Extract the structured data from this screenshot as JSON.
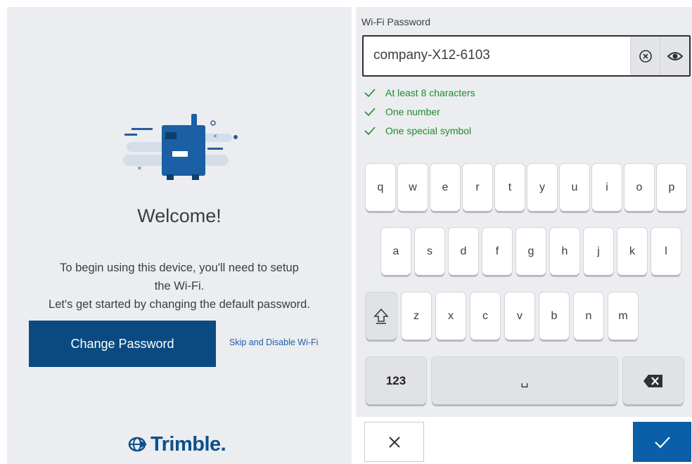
{
  "welcome": {
    "title": "Welcome!",
    "intro_line1": "To begin using this device, you'll need to setup",
    "intro_line2": "the Wi-Fi.",
    "intro_line3": "Let's get started by changing the default password.",
    "change_password_label": "Change Password",
    "skip_label": "Skip and Disable Wi-Fi",
    "logo_text": "Trimble."
  },
  "password": {
    "label": "Wi-Fi Password",
    "value": "company-X12-6103",
    "rules": [
      {
        "text": "At least 8 characters",
        "status": "met"
      },
      {
        "text": "One number",
        "status": "met"
      },
      {
        "text": "One special symbol",
        "status": "met"
      }
    ]
  },
  "keyboard": {
    "row1": [
      "q",
      "w",
      "e",
      "r",
      "t",
      "y",
      "u",
      "i",
      "o",
      "p"
    ],
    "row2": [
      "a",
      "s",
      "d",
      "f",
      "g",
      "h",
      "j",
      "k",
      "l"
    ],
    "row3": [
      "z",
      "x",
      "c",
      "v",
      "b",
      "n",
      "m"
    ],
    "numbers_label": "123",
    "space_glyph": "␣",
    "shift_icon": "shift-icon",
    "backspace_icon": "backspace-icon"
  },
  "actions": {
    "cancel_icon": "close-icon",
    "confirm_icon": "check-icon"
  },
  "colors": {
    "primary": "#0a4a80",
    "confirm": "#0a5fa8",
    "success": "#1f8a2e",
    "link": "#1f5fa3",
    "panel_bg": "#ecedf0"
  }
}
